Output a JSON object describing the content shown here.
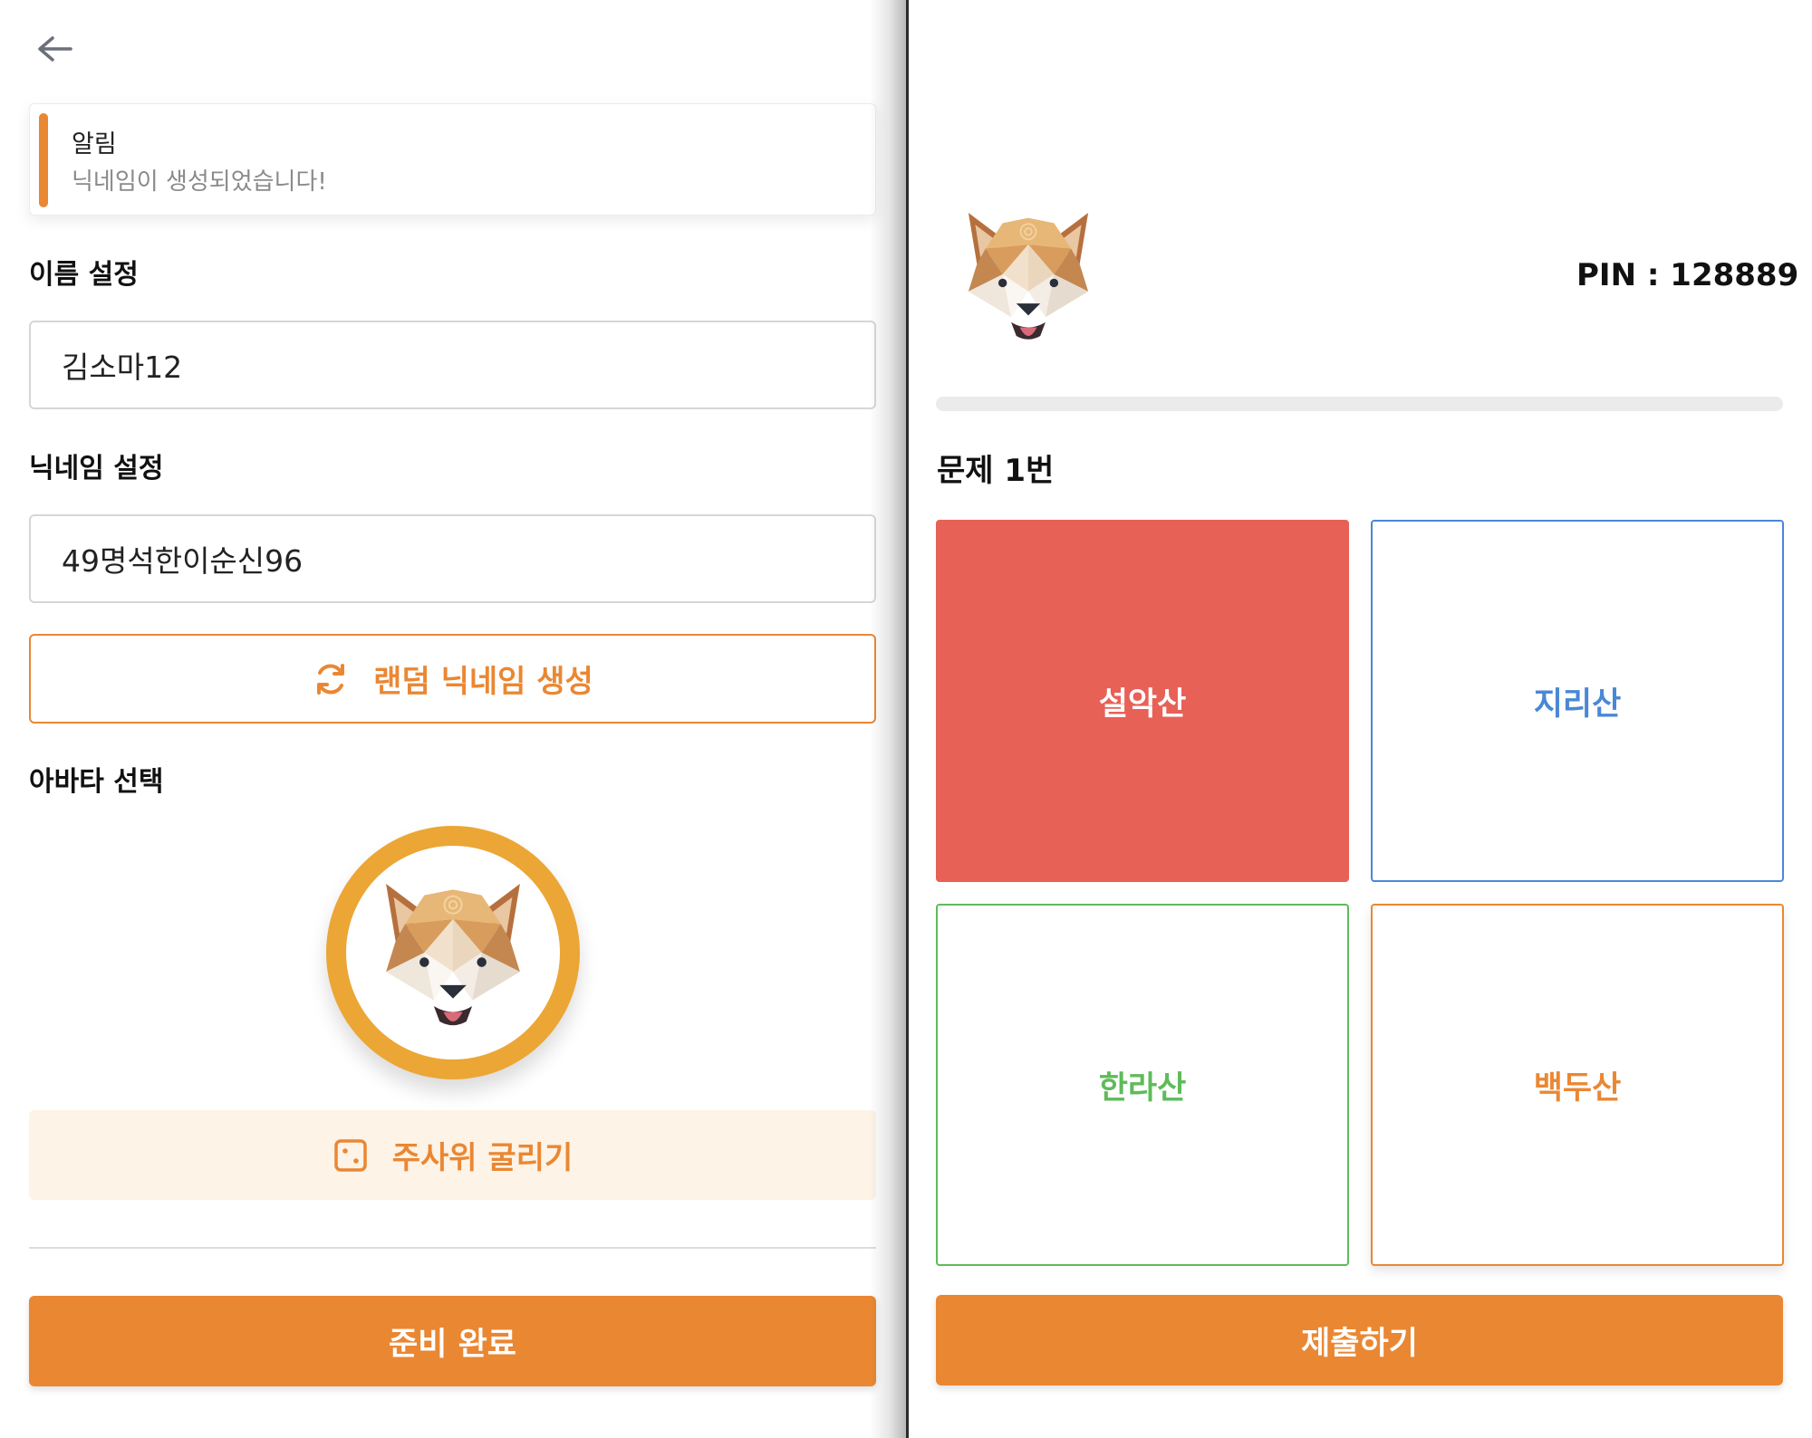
{
  "left_panel": {
    "back_icon": "arrow-left-icon",
    "toast": {
      "title": "알림",
      "message": "닉네임이 생성되었습니다!",
      "accent": "#ea8733"
    },
    "name_section": {
      "label": "이름 설정",
      "value": "김소마12"
    },
    "nickname_section": {
      "label": "닉네임 설정",
      "value": "49명석한이순신96",
      "random_button_label": "랜덤 닉네임 생성",
      "random_button_icon": "refresh-icon"
    },
    "avatar_section": {
      "label": "아바타 선택",
      "avatar": "dog-avatar-icon",
      "ring_color": "#eca635",
      "dice_button_label": "주사위 굴리기",
      "dice_button_icon": "dice-icon"
    },
    "ready_button_label": "준비 완료"
  },
  "right_panel": {
    "avatar": "dog-avatar-icon",
    "pin_text": "PIN : 128889",
    "progress": 0,
    "question_title": "문제 1번",
    "choices": [
      {
        "label": "설악산",
        "color": "#e86157",
        "selected": true
      },
      {
        "label": "지리산",
        "color": "#4a87d6",
        "selected": false
      },
      {
        "label": "한라산",
        "color": "#5fbb5a",
        "selected": false
      },
      {
        "label": "백두산",
        "color": "#ea8733",
        "selected": false
      }
    ],
    "submit_button_label": "제출하기"
  },
  "colors": {
    "primary": "#ea8733",
    "primary_soft": "#fdf3e6"
  }
}
